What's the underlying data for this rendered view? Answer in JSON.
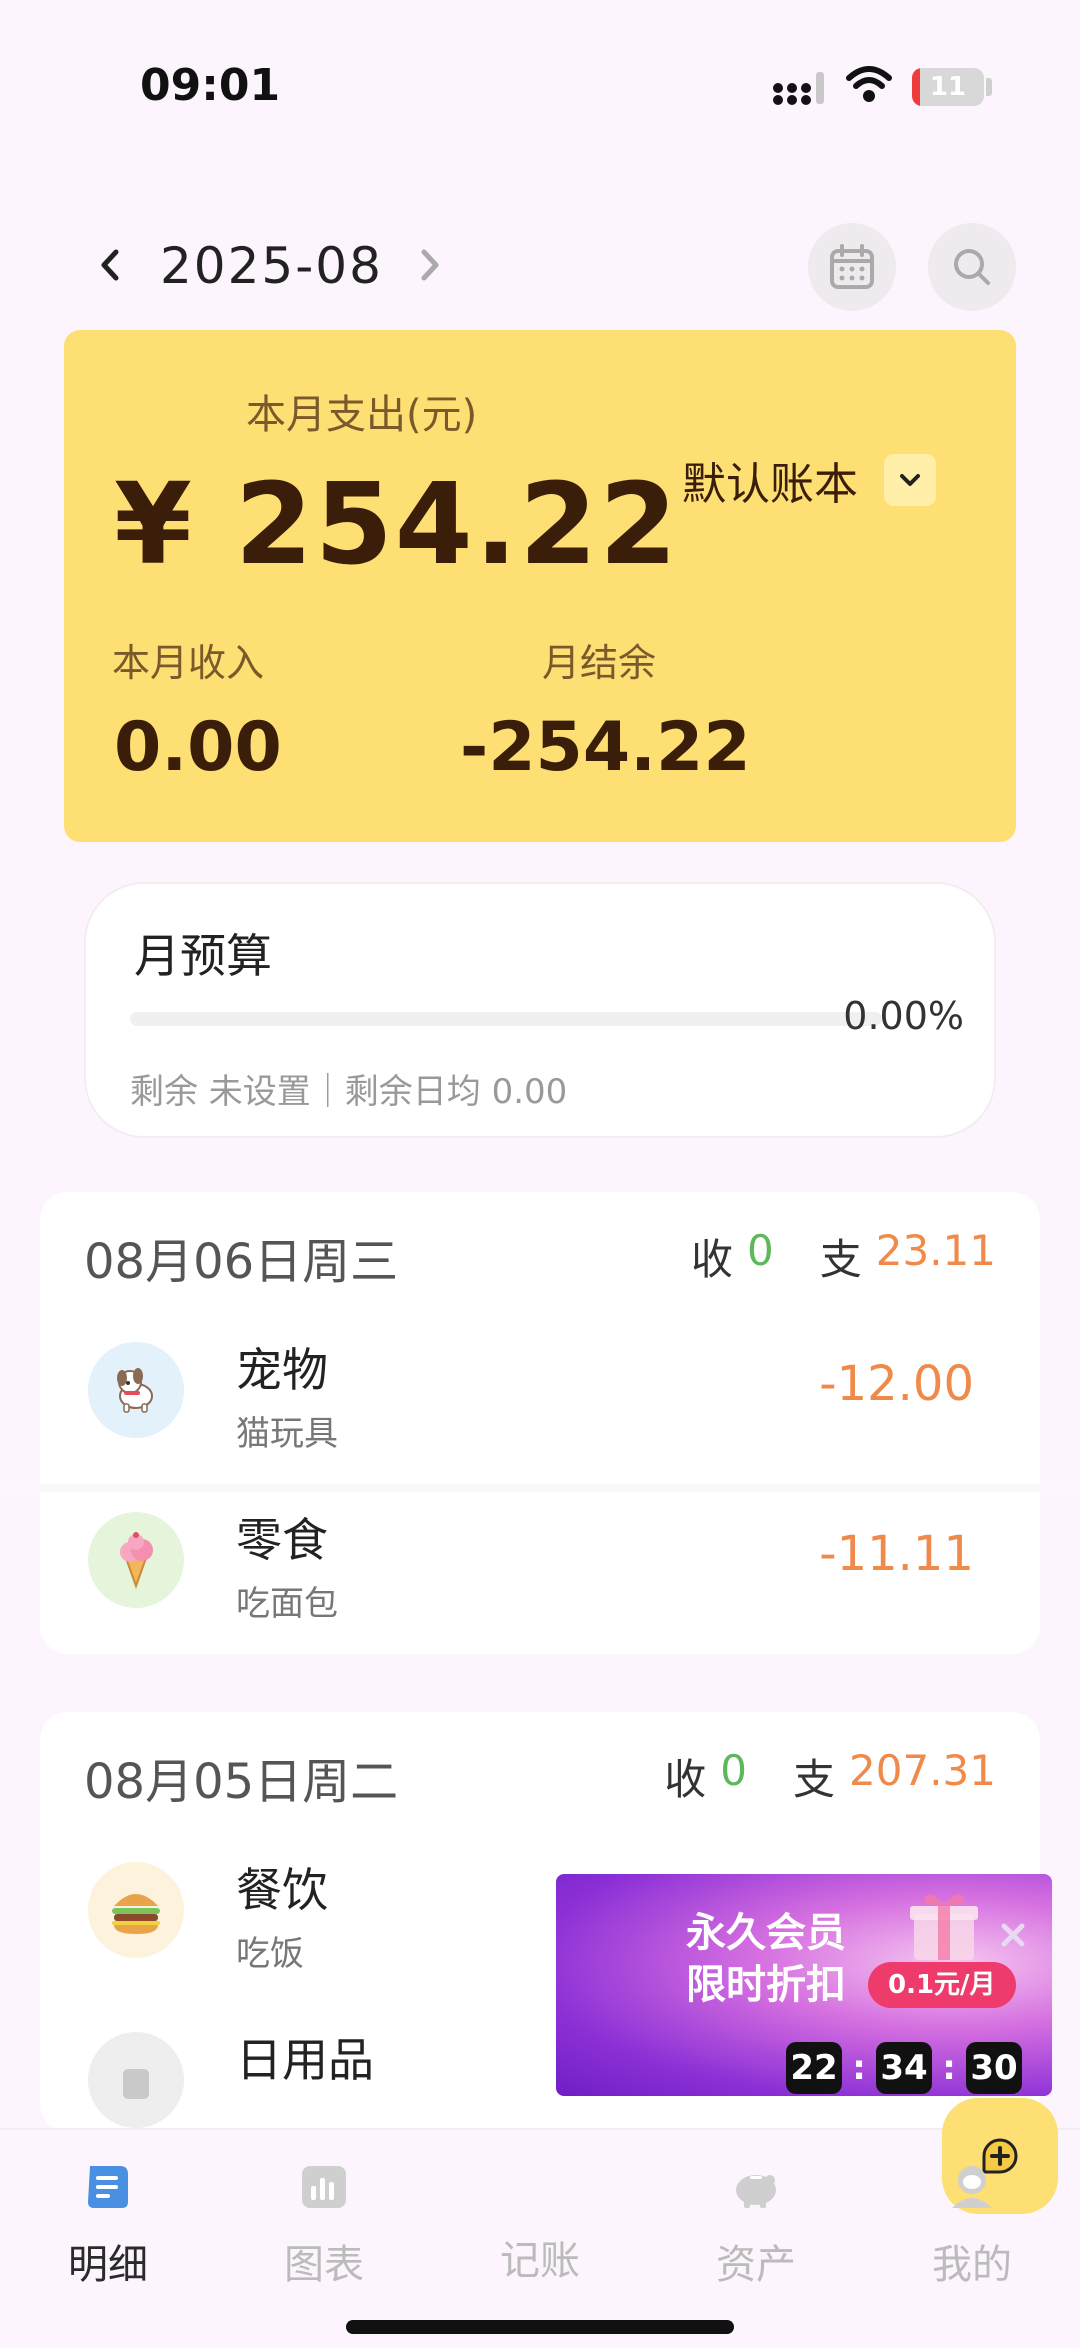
{
  "status_bar": {
    "time": "09:01",
    "battery_level": "11",
    "battery_fraction": 0.11
  },
  "header": {
    "month": "2025-08",
    "icons": [
      "chevron-left-icon",
      "chevron-right-icon",
      "calendar-icon",
      "search-icon"
    ]
  },
  "summary": {
    "expense_label": "本月支出(元)",
    "expense_value": "¥ 254.22",
    "book_name": "默认账本",
    "income_label": "本月收入",
    "income_value": "0.00",
    "balance_label": "月结余",
    "balance_value": "-254.22",
    "accent_color": "#FDDF74"
  },
  "budget": {
    "title": "月预算",
    "percent": "0.00%",
    "progress_fraction": 0.0,
    "remaining_text": "剩余 未设置｜剩余日均 0.00"
  },
  "days": [
    {
      "date": "08月06日周三",
      "income_label": "收",
      "income_total": "0",
      "expense_label": "支",
      "expense_total": "23.11",
      "transactions": [
        {
          "category": "宠物",
          "note": "猫玩具",
          "amount": "-12.00",
          "icon": "dog-icon"
        },
        {
          "category": "零食",
          "note": "吃面包",
          "amount": "-11.11",
          "icon": "ice-cream-icon"
        }
      ]
    },
    {
      "date": "08月05日周二",
      "income_label": "收",
      "income_total": "0",
      "expense_label": "支",
      "expense_total": "207.31",
      "transactions": [
        {
          "category": "餐饮",
          "note": "吃饭",
          "amount": "",
          "icon": "burger-icon"
        },
        {
          "category": "日用品",
          "note": "",
          "amount": "",
          "icon": "daily-goods-icon"
        }
      ]
    }
  ],
  "promo": {
    "line1": "永久会员",
    "line2": "限时折扣",
    "price": "0.1元/月",
    "countdown": {
      "hours": "22",
      "minutes": "34",
      "seconds": "30"
    }
  },
  "nav": {
    "items": [
      {
        "label": "明细",
        "icon": "list-icon",
        "active": true
      },
      {
        "label": "图表",
        "icon": "chart-icon",
        "active": false
      },
      {
        "label": "记账",
        "icon": "add-record-icon",
        "active": false
      },
      {
        "label": "资产",
        "icon": "piggy-bank-icon",
        "active": false
      },
      {
        "label": "我的",
        "icon": "profile-icon",
        "active": false
      }
    ]
  },
  "colors": {
    "income": "#5DB85B",
    "expense": "#F08A4B",
    "background": "#FDF5FD"
  }
}
